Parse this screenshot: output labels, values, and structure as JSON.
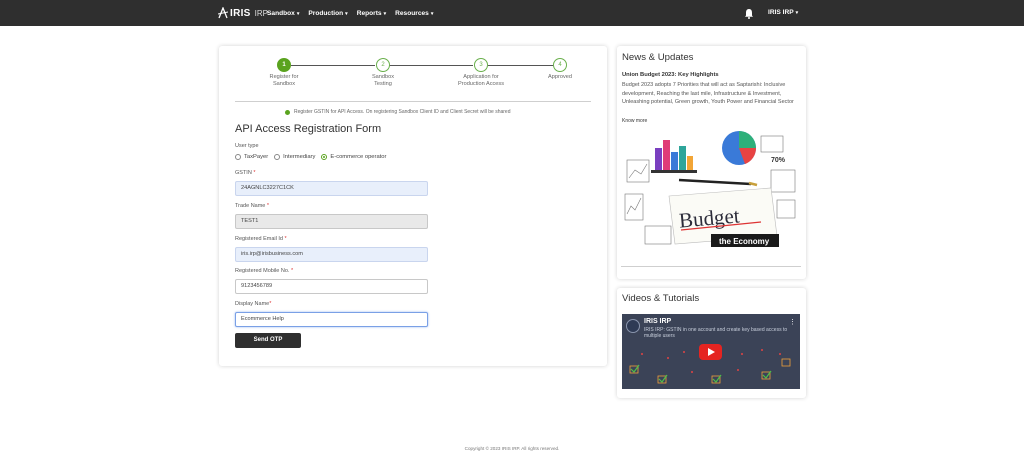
{
  "header": {
    "logo_text": "IRIS",
    "logo_sub": "IRP",
    "nav": [
      {
        "label": "Sandbox"
      },
      {
        "label": "Production"
      },
      {
        "label": "Reports"
      },
      {
        "label": "Resources"
      }
    ],
    "user_label": "IRIS IRP"
  },
  "stepper": {
    "steps": [
      {
        "number": "1",
        "label": "Register for Sandbox"
      },
      {
        "number": "2",
        "label": "Sandbox Testing"
      },
      {
        "number": "3",
        "label": "Application for Production Access"
      },
      {
        "number": "4",
        "label": "Approved"
      }
    ],
    "active_step": 1
  },
  "notice": "Register GSTIN for API Access. On registering Sandbox Client ID and Client Secret will be shared",
  "form": {
    "title": "API Access Registration Form",
    "user_type_label": "User type",
    "user_types": [
      "TaxPayer",
      "Intermediary",
      "E-commerce operator"
    ],
    "selected_user_type": "E-commerce operator",
    "gstin_label": "GSTIN",
    "gstin_value": "24AGNLC3227C1CK",
    "trade_name_label": "Trade Name",
    "trade_name_value": "TEST1",
    "email_label": "Registered Email Id",
    "email_value": "iris.irp@irisbusiness.com",
    "mobile_label": "Registered Mobile No.",
    "mobile_value": "9123456789",
    "display_name_label": "Display Name",
    "display_name_value": "Ecommerce Help",
    "required_mark": "*",
    "submit_label": "Send OTP"
  },
  "news": {
    "title": "News & Updates",
    "headline": "Union Budget 2023: Key Highlights",
    "body": "Budget 2023 adopts 7 Priorities that will act as Saptarishi: Inclusive development, Reaching the last mile, Infrastructure & Investment, Unleashing potential, Green growth, Youth Power and Financial Sector",
    "more_label": "Know more",
    "image_text_main": "Budget",
    "image_text_sub": "the Economy",
    "image_percent": "70%"
  },
  "videos": {
    "title": "Videos & Tutorials",
    "channel": "IRIS IRP",
    "video_caption": "IRIS IRP: GSTIN in one account and create key based access to multiple users"
  },
  "footer": "Copyright © 2023 IRIS IRP. All rights reserved.",
  "colors": {
    "topbar": "#2f2f2f",
    "accent_green": "#5aa31f",
    "input_blue": "#e8effb",
    "button_dark": "#2f2f2f",
    "play_red": "#e52421"
  }
}
